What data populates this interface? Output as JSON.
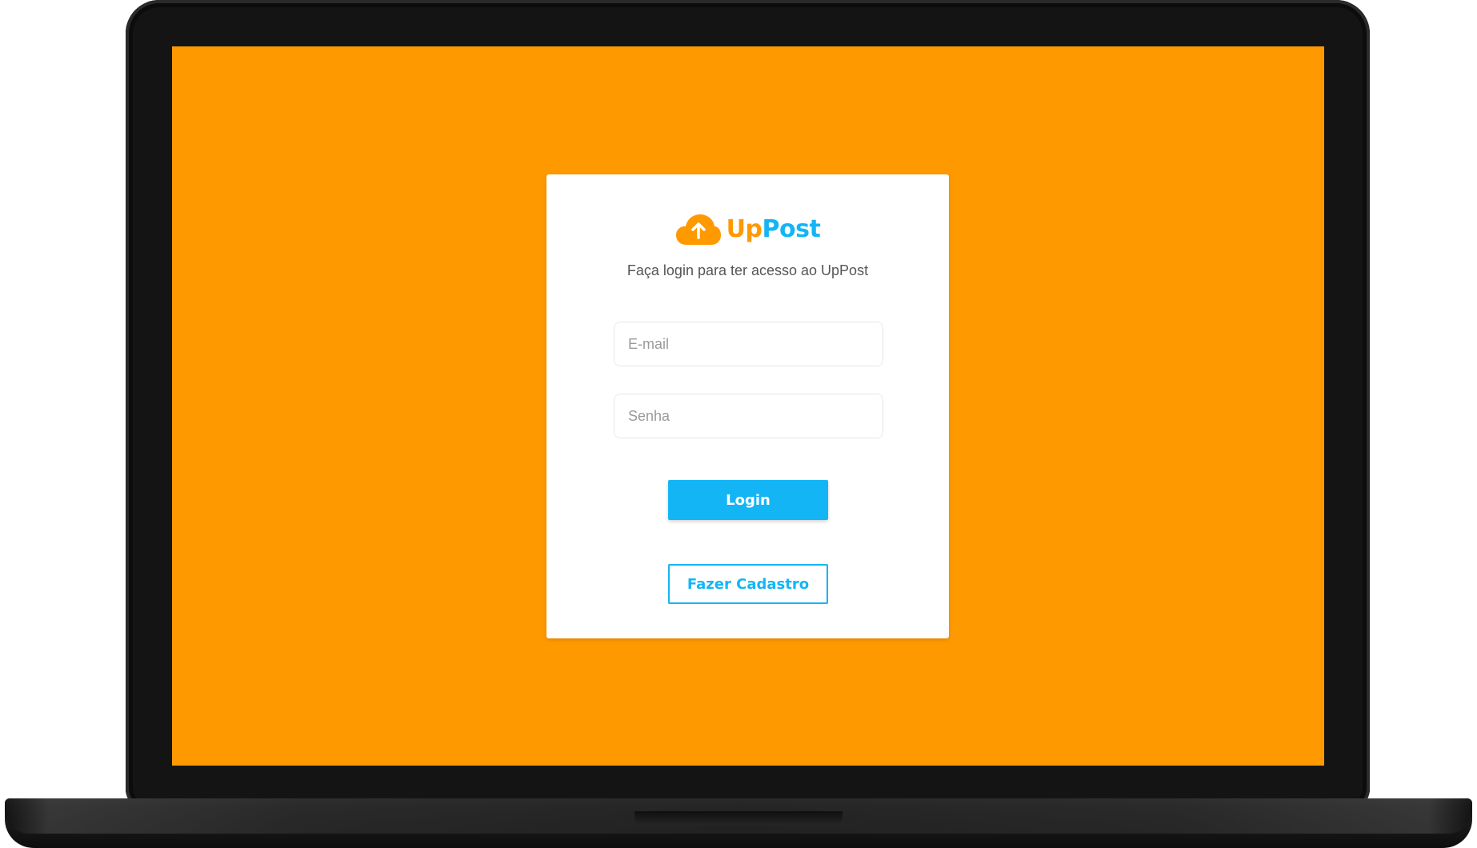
{
  "app": {
    "brand_part1": "Up",
    "brand_part2": "Post",
    "logo_icon": "cloud-upload-icon"
  },
  "login": {
    "subtitle": "Faça login para ter acesso ao UpPost",
    "email_placeholder": "E-mail",
    "email_value": "",
    "password_placeholder": "Senha",
    "password_value": "",
    "login_label": "Login",
    "register_label": "Fazer Cadastro"
  },
  "colors": {
    "background": "#ff9900",
    "brand_orange": "#ff9900",
    "brand_blue": "#13b5f5",
    "card": "#ffffff"
  }
}
